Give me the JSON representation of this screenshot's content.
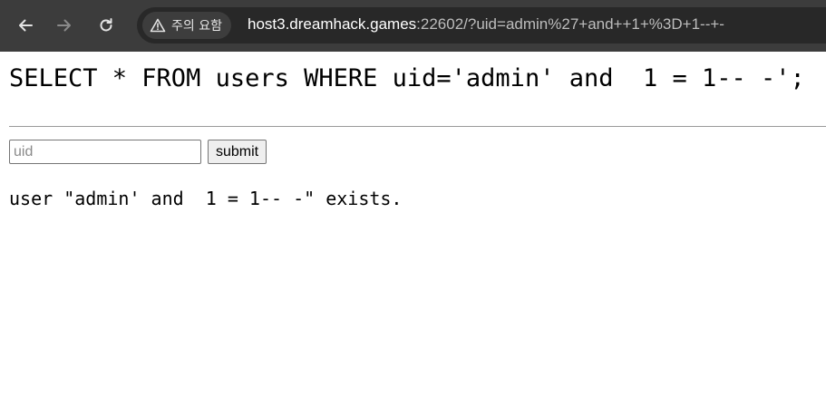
{
  "browser": {
    "back_icon": "arrow-left-icon",
    "forward_icon": "arrow-right-icon",
    "reload_icon": "reload-icon",
    "security_icon": "warning-triangle-icon",
    "security_label": "주의 요함",
    "url_host": "host3.dreamhack.games",
    "url_rest": ":22602/?uid=admin%27+and++1+%3D+1--+-"
  },
  "page": {
    "query": "SELECT * FROM users WHERE uid='admin' and  1 = 1-- -';",
    "input_placeholder": "uid",
    "input_value": "",
    "submit_label": "submit",
    "result": "user \"admin' and  1 = 1-- -\" exists."
  },
  "colors": {
    "toolbar_bg": "#3c3c3c",
    "omnibox_bg": "#282828",
    "chip_bg": "#3d3d3d"
  }
}
